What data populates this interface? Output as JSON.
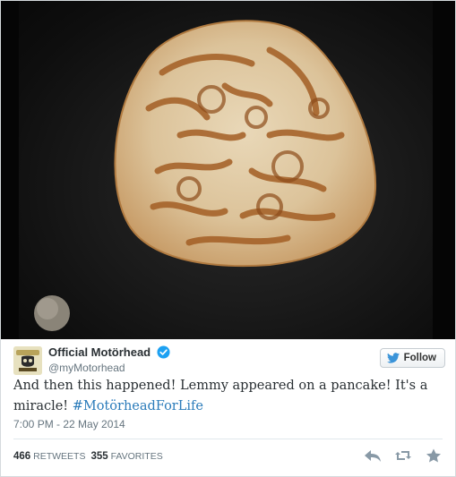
{
  "tweet": {
    "author_name": "Official Motörhead",
    "author_handle": "@myMotorhead",
    "follow_label": "Follow",
    "text_plain": "And then this happened! Lemmy appeared on a pancake! It's a miracle! ",
    "hashtag": "#MotörheadForLife",
    "timestamp": "7:00 PM - 22 May 2014",
    "retweets_count": "466",
    "retweets_label": "RETWEETS",
    "favorites_count": "355",
    "favorites_label": "FAVORITES"
  },
  "colors": {
    "link": "#2a7bba",
    "verified": "#1da1f2",
    "twitter_bird": "#3b94d9",
    "action_icons": "#8899a6"
  },
  "icons": [
    "verified-icon",
    "twitter-bird-icon",
    "reply-icon",
    "retweet-icon",
    "favorite-icon"
  ]
}
